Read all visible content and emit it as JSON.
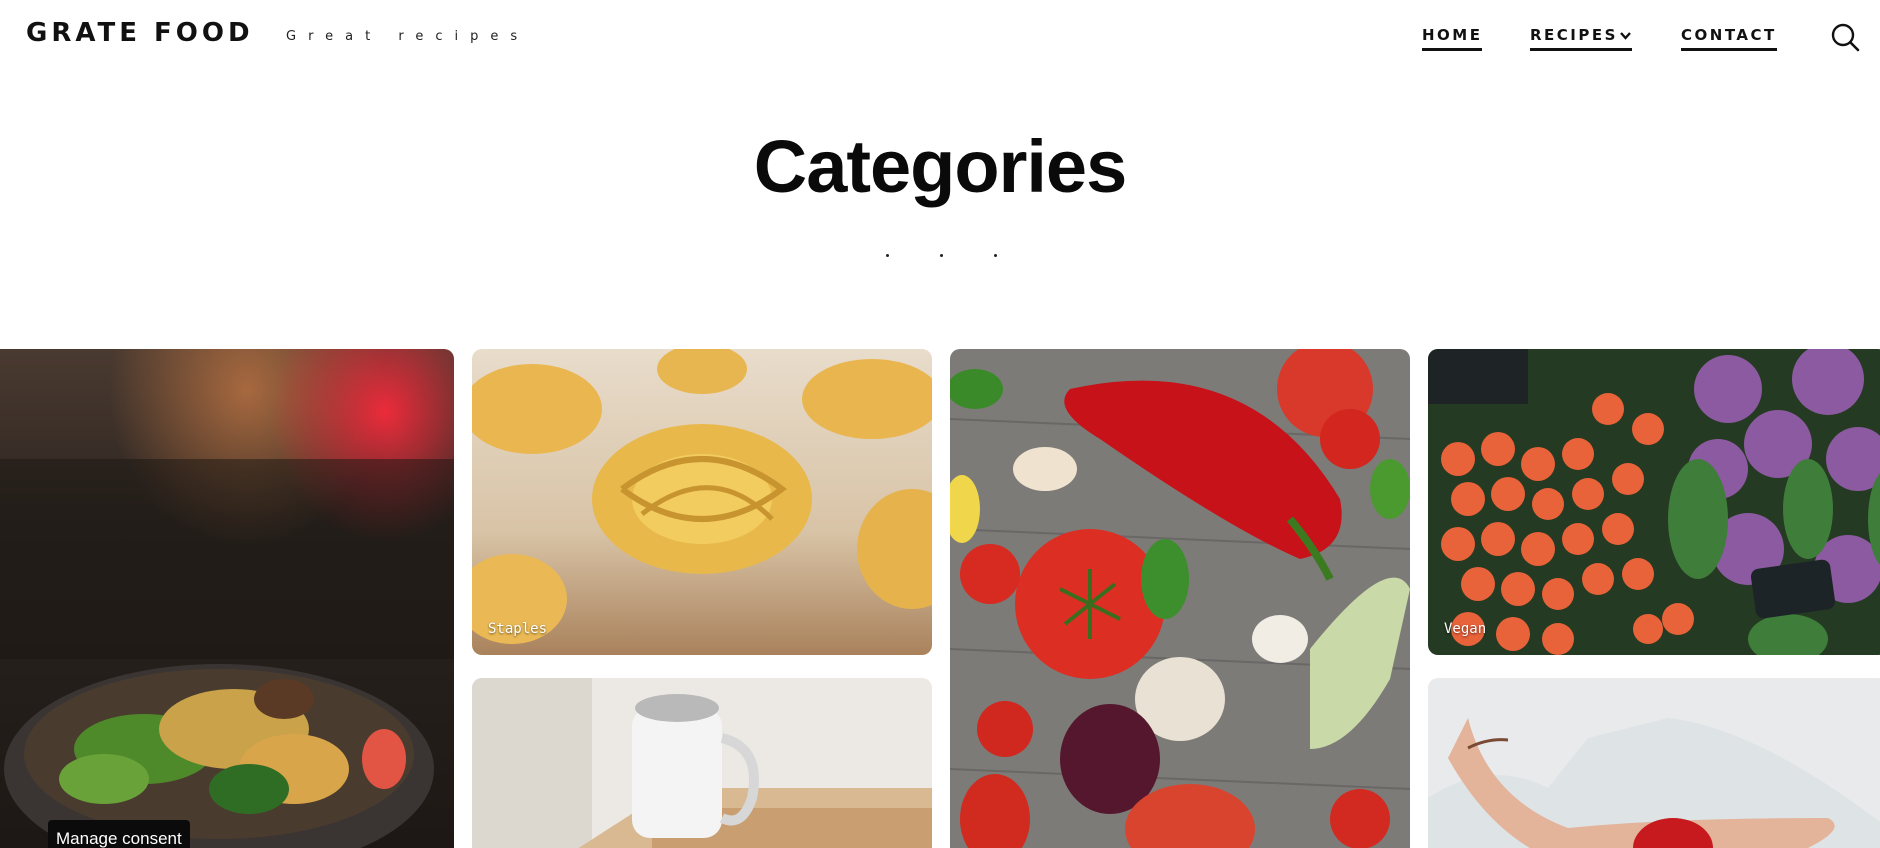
{
  "header": {
    "brand": "GRATE FOOD",
    "tagline": "Great recipes",
    "nav": {
      "home": "HOME",
      "recipes": "RECIPES",
      "contact": "CONTACT"
    },
    "search_icon": "search-icon",
    "recipes_icon": "chevron-down-icon"
  },
  "main": {
    "title": "Categories",
    "cards": {
      "staples": "Staples",
      "vegan": "Vegan"
    }
  },
  "consent": {
    "label": "Manage consent"
  },
  "colors": {
    "text": "#000000",
    "background": "#ffffff",
    "consent_bg": "#0b0b0b"
  }
}
